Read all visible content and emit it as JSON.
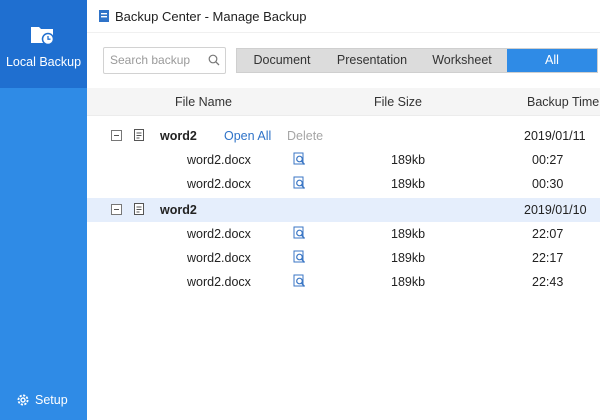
{
  "sidebar": {
    "local_backup_label": "Local Backup",
    "setup_label": "Setup"
  },
  "window": {
    "title": "Backup Center - Manage Backup"
  },
  "search": {
    "placeholder": "Search backup",
    "value": ""
  },
  "tabs": [
    {
      "label": "Document",
      "active": false
    },
    {
      "label": "Presentation",
      "active": false
    },
    {
      "label": "Worksheet",
      "active": false
    },
    {
      "label": "All",
      "active": true
    }
  ],
  "columns": {
    "file_name": "File Name",
    "file_size": "File Size",
    "backup_time": "Backup Time"
  },
  "groups": [
    {
      "name": "word2",
      "open_all": "Open All",
      "delete": "Delete",
      "date": "2019/01/11",
      "files": [
        {
          "name": "word2.docx",
          "size": "189kb",
          "time": "00:27"
        },
        {
          "name": "word2.docx",
          "size": "189kb",
          "time": "00:30"
        }
      ]
    },
    {
      "name": "word2",
      "date": "2019/01/10",
      "selected": true,
      "files": [
        {
          "name": "word2.docx",
          "size": "189kb",
          "time": "22:07"
        },
        {
          "name": "word2.docx",
          "size": "189kb",
          "time": "22:17"
        },
        {
          "name": "word2.docx",
          "size": "189kb",
          "time": "22:43"
        }
      ]
    }
  ],
  "colors": {
    "sidebar": "#2f8be6",
    "sidebar_active": "#1f6fd0",
    "tab_active": "#2f8be6",
    "row_selected": "#e5eefc",
    "link": "#2f73c8"
  },
  "icons": {
    "local_backup": "folder-clock-icon",
    "setup": "gear-icon",
    "search": "search-icon",
    "doc": "document-icon",
    "preview": "preview-icon",
    "expander": "collapse-icon"
  }
}
